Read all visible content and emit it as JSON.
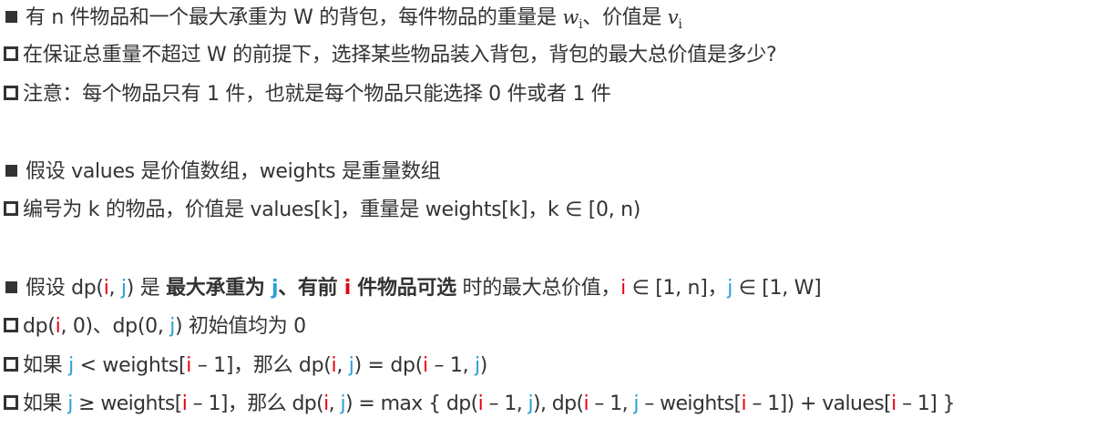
{
  "lines": {
    "l1": {
      "text1": "有 n 件物品和一个最大承重为 W 的背包，每件物品的重量是 ",
      "w": "w",
      "w_sub": "i",
      "text2": "、价值是 ",
      "v": "v",
      "v_sub": "i"
    },
    "l2": {
      "text": "在保证总重量不超过 W 的前提下，选择某些物品装入背包，背包的最大总价值是多少?"
    },
    "l3": {
      "text": "注意：每个物品只有 1 件，也就是每个物品只能选择 0 件或者 1 件"
    },
    "l4": {
      "text": "假设 values 是价值数组，weights 是重量数组"
    },
    "l5": {
      "text": "编号为 k 的物品，价值是 values[k]，重量是 weights[k]，k ∈ [0, n)"
    },
    "l6": {
      "t1": "假设 dp(",
      "i": "i",
      "comma": ", ",
      "j": "j",
      "t2": ") 是 ",
      "b1": "最大承重为 ",
      "bj": "j",
      "b2": "、有前 ",
      "bi": "i",
      "b3": " 件物品可选",
      "t3": " 时的最大总价值，",
      "i2": "i",
      "t4": " ∈ [1, n]，",
      "j2": "j",
      "t5": " ∈ [1, W]"
    },
    "l7": {
      "t1": "dp(",
      "i": "i",
      "t2": ", 0)、dp(0, ",
      "j": "j",
      "t3": ") 初始值均为 0"
    },
    "l8": {
      "t1": "如果 ",
      "j": "j",
      "t2": " < weights[",
      "i": "i",
      "t3": " – 1]，那么 dp(",
      "i2": "i",
      "t4": ", ",
      "j2": "j",
      "t5": ") = dp(",
      "i3": "i",
      "t6": " – 1, ",
      "j3": "j",
      "t7": ")"
    },
    "l9": {
      "t1": "如果 ",
      "j": "j",
      "t2": " ≥ weights[",
      "i": "i",
      "t3": " – 1]，那么 dp(",
      "i2": "i",
      "t4": ", ",
      "j2": "j",
      "t5": ") = max { dp(",
      "i3": "i",
      "t6": " – 1, ",
      "j3": "j",
      "t7": "), dp(",
      "i4": "i",
      "t8": " – 1, ",
      "j4": "j",
      "t9": " – weights[",
      "i5": "i",
      "t10": " – 1]) + values[",
      "i6": "i",
      "t11": " – 1] }"
    }
  },
  "colors": {
    "text": "#333333",
    "i_var": "#e60012",
    "j_var": "#2a9fd8"
  },
  "icons": {
    "primary_bullet": "filled-square-bullet-icon",
    "secondary_bullet": "hollow-square-bullet-icon"
  }
}
